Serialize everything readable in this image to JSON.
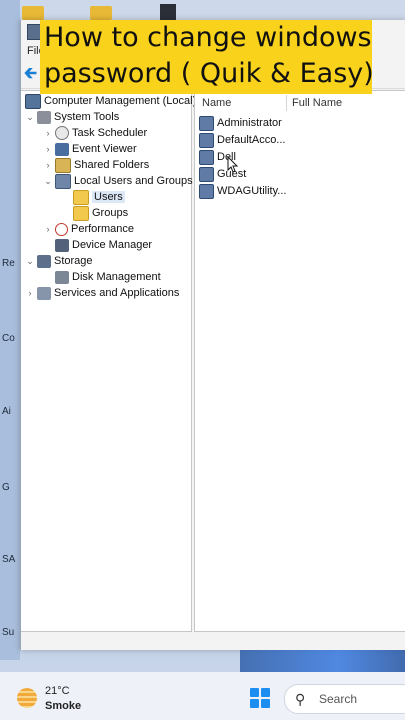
{
  "caption": {
    "line1": "How to change windows",
    "line2": "password ( Quik & Easy)"
  },
  "window": {
    "menu_file": "File"
  },
  "desktop_fragments": [
    "Re",
    "Co",
    "Ai",
    "G",
    "SA",
    "Su"
  ],
  "tree": {
    "items": [
      {
        "label": "Computer Management (Local)",
        "icon": "computer-icon"
      },
      {
        "label": "System Tools",
        "icon": "tools-icon",
        "expanded": true
      },
      {
        "label": "Task Scheduler",
        "icon": "clock-icon"
      },
      {
        "label": "Event Viewer",
        "icon": "event-viewer-icon"
      },
      {
        "label": "Shared Folders",
        "icon": "shared-folder-icon"
      },
      {
        "label": "Local Users and Groups",
        "icon": "users-icon",
        "expanded": true
      },
      {
        "label": "Users",
        "icon": "folder-icon",
        "selected": true
      },
      {
        "label": "Groups",
        "icon": "folder-icon"
      },
      {
        "label": "Performance",
        "icon": "performance-icon"
      },
      {
        "label": "Device Manager",
        "icon": "device-manager-icon"
      },
      {
        "label": "Storage",
        "icon": "storage-icon",
        "expanded": true
      },
      {
        "label": "Disk Management",
        "icon": "disk-icon"
      },
      {
        "label": "Services and Applications",
        "icon": "services-icon"
      }
    ]
  },
  "list": {
    "columns": [
      "Name",
      "Full Name"
    ],
    "users": [
      "Administrator",
      "DefaultAcco...",
      "Dell",
      "Guest",
      "WDAGUtility..."
    ]
  },
  "taskbar": {
    "temperature": "21°C",
    "condition": "Smoke",
    "search_placeholder": "Search"
  },
  "colors": {
    "caption_bg": "#f8d21b",
    "accent": "#1c8ef0"
  }
}
